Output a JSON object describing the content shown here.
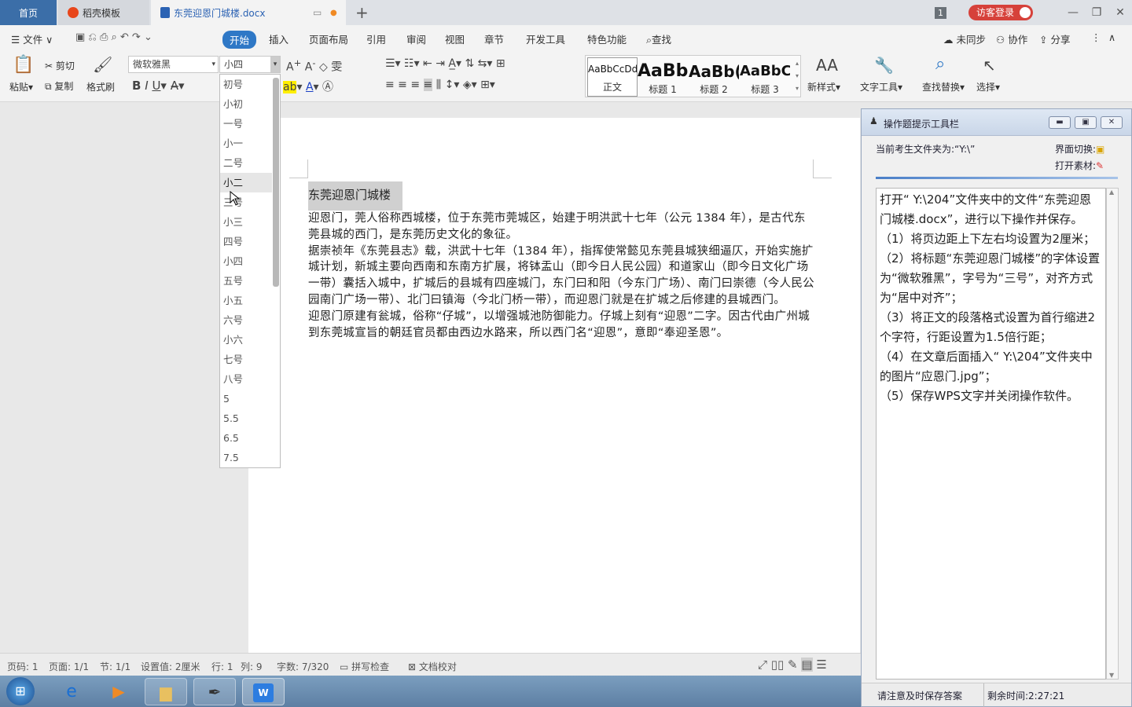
{
  "tabs": {
    "home": "首页",
    "template": "稻壳模板",
    "doc": "东莞迎恩门城楼.docx"
  },
  "titlebar": {
    "count": "1",
    "login": "访客登录"
  },
  "menu": {
    "file": "文件",
    "items": [
      "开始",
      "插入",
      "页面布局",
      "引用",
      "审阅",
      "视图",
      "章节",
      "开发工具",
      "特色功能"
    ],
    "search": "查找",
    "sync": "未同步",
    "collab": "协作",
    "share": "分享"
  },
  "toolbar": {
    "paste": "粘贴",
    "cut": "剪切",
    "copy": "复制",
    "format_brush": "格式刷",
    "font_name": "微软雅黑",
    "font_size": "小四",
    "styles": [
      {
        "preview": "AaBbCcDd",
        "name": "正文"
      },
      {
        "preview": "AaBb",
        "name": "标题 1"
      },
      {
        "preview": "AaBb(",
        "name": "标题 2"
      },
      {
        "preview": "AaBbC",
        "name": "标题 3"
      }
    ],
    "new_style": "新样式",
    "text_tools": "文字工具",
    "find_replace": "查找替换",
    "select": "选择"
  },
  "font_size_options": [
    "初号",
    "小初",
    "一号",
    "小一",
    "二号",
    "小二",
    "三号",
    "小三",
    "四号",
    "小四",
    "五号",
    "小五",
    "六号",
    "小六",
    "七号",
    "八号",
    "5",
    "5.5",
    "6.5",
    "7.5"
  ],
  "font_size_highlighted": "小二",
  "document": {
    "title": "东莞迎恩门城楼",
    "paragraphs": [
      "迎恩门，莞人俗称西城楼，位于东莞市莞城区，始建于明洪武十七年（公元 1384 年），是古代东莞县城的西门，是东莞历史文化的象征。",
      "据崇祯年《东莞县志》载，洪武十七年（1384 年），指挥使常懿见东莞县城狭细逼仄，开始实施扩城计划，新城主要向西南和东南方扩展，将钵盂山（即今日人民公园）和道家山（即今日文化广场一带）囊括入城中，扩城后的县城有四座城门，东门曰和阳（今东门广场）、南门曰崇德（今人民公园南门广场一带）、北门曰镇海（今北门桥一带），而迎恩门就是在扩城之后修建的县城西门。",
      "迎恩门原建有瓮城，俗称“仔城”，以增强城池防御能力。仔城上刻有“迎恩”二字。因古代由广州城到东莞城宣旨的朝廷官员都由西边水路来，所以西门名“迎恩”，意即“奉迎圣恩”。"
    ]
  },
  "status": {
    "page_code": "页码: 1",
    "pages": "页面: 1/1",
    "section": "节: 1/1",
    "setting": "设置值: 2厘米",
    "row": "行: 1",
    "col": "列: 9",
    "words": "字数: 7/320",
    "spell": "拼写检查",
    "proof": "文档校对"
  },
  "helper": {
    "title": "操作题提示工具栏",
    "folder": "当前考生文件夹为:“Y:\\”",
    "switch": "界面切换:",
    "open_material": "打开素材:",
    "instructions": [
      "打开“ Y:\\204”文件夹中的文件“东莞迎恩门城楼.docx”，进行以下操作并保存。",
      "（1）将页边距上下左右均设置为2厘米；",
      "（2）将标题“东莞迎恩门城楼”的字体设置为“微软雅黑”，字号为“三号”，对齐方式为“居中对齐”；",
      "（3）将正文的段落格式设置为首行缩进2个字符，行距设置为1.5倍行距；",
      "（4）在文章后面插入“ Y:\\204”文件夹中的图片“应恩门.jpg”；",
      "（5）保存WPS文字并关闭操作软件。"
    ],
    "save_note": "请注意及时保存答案",
    "time_left": "剩余时间:2:27:21"
  },
  "colors": {
    "accent": "#2f78c6",
    "login": "#d6413a",
    "home_tab": "#3b6ea8"
  }
}
